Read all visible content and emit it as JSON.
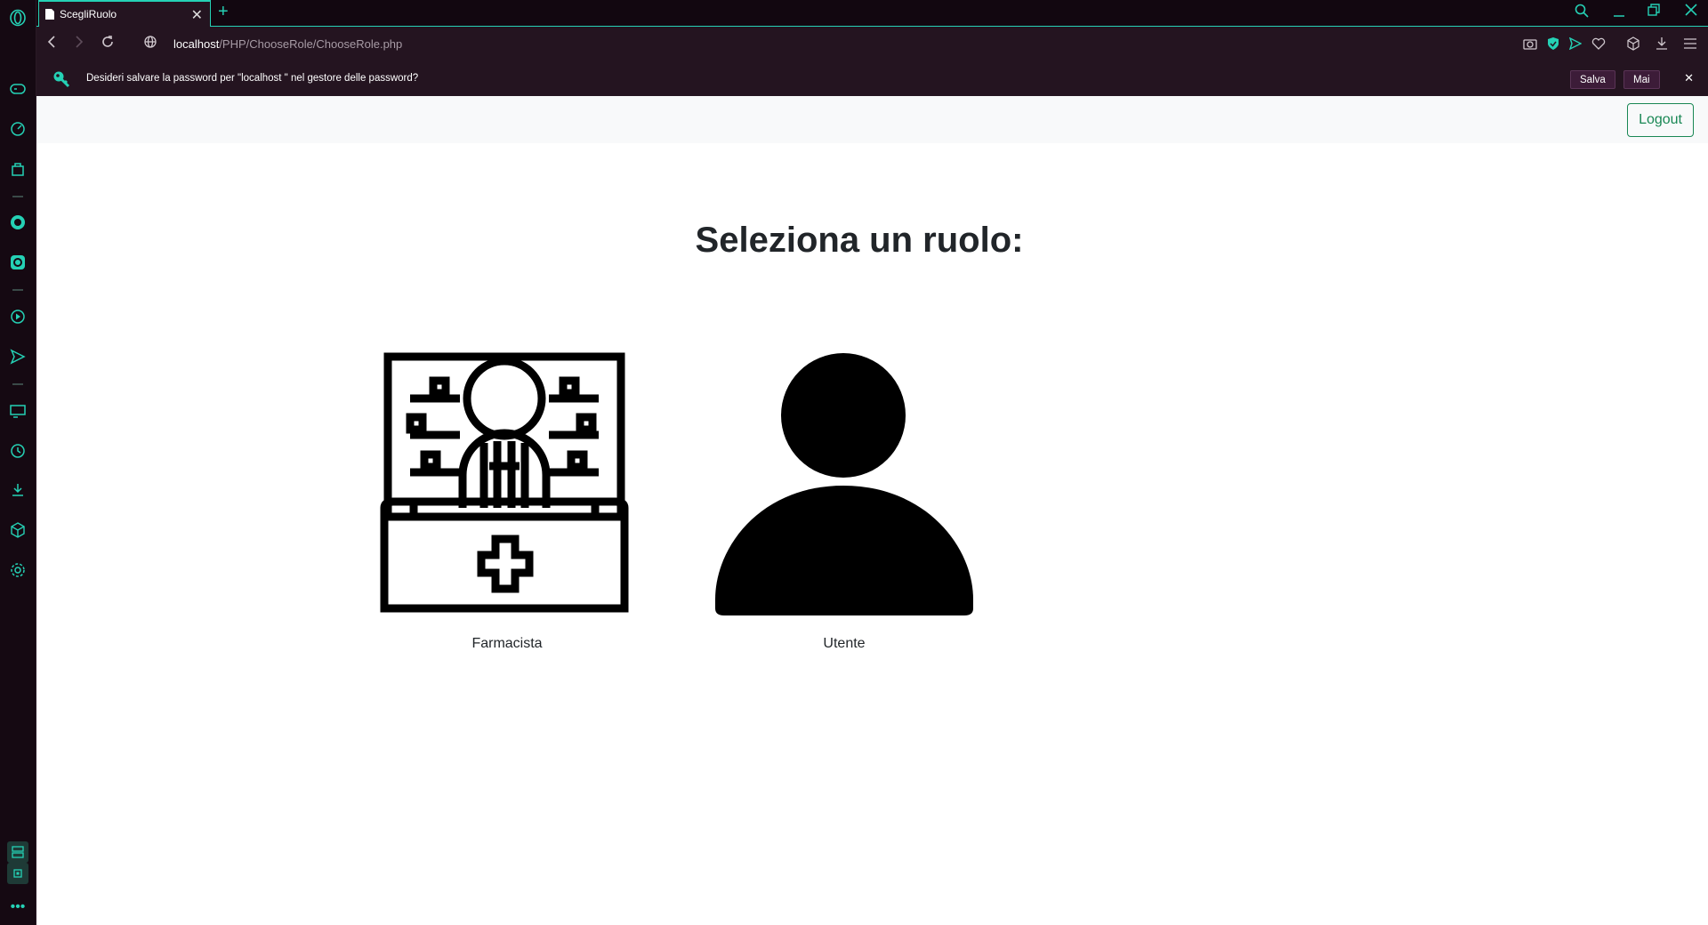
{
  "browser": {
    "tab_title": "ScegliRuolo",
    "new_tab_symbol": "+",
    "url_host": "localhost",
    "url_path": "/PHP/ChooseRole/ChooseRole.php"
  },
  "password_prompt": {
    "message": "Desideri salvare la password per \"localhost \" nel gestore delle password?",
    "save_label": "Salva",
    "never_label": "Mai"
  },
  "navbar": {
    "logout_label": "Logout"
  },
  "main": {
    "heading": "Seleziona un ruolo:",
    "roles": [
      {
        "label": "Farmacista",
        "icon": "pharmacist-icon"
      },
      {
        "label": "Utente",
        "icon": "user-icon"
      }
    ]
  },
  "colors": {
    "accent": "#25d1b5",
    "logout": "#198754",
    "heading": "#212529"
  }
}
